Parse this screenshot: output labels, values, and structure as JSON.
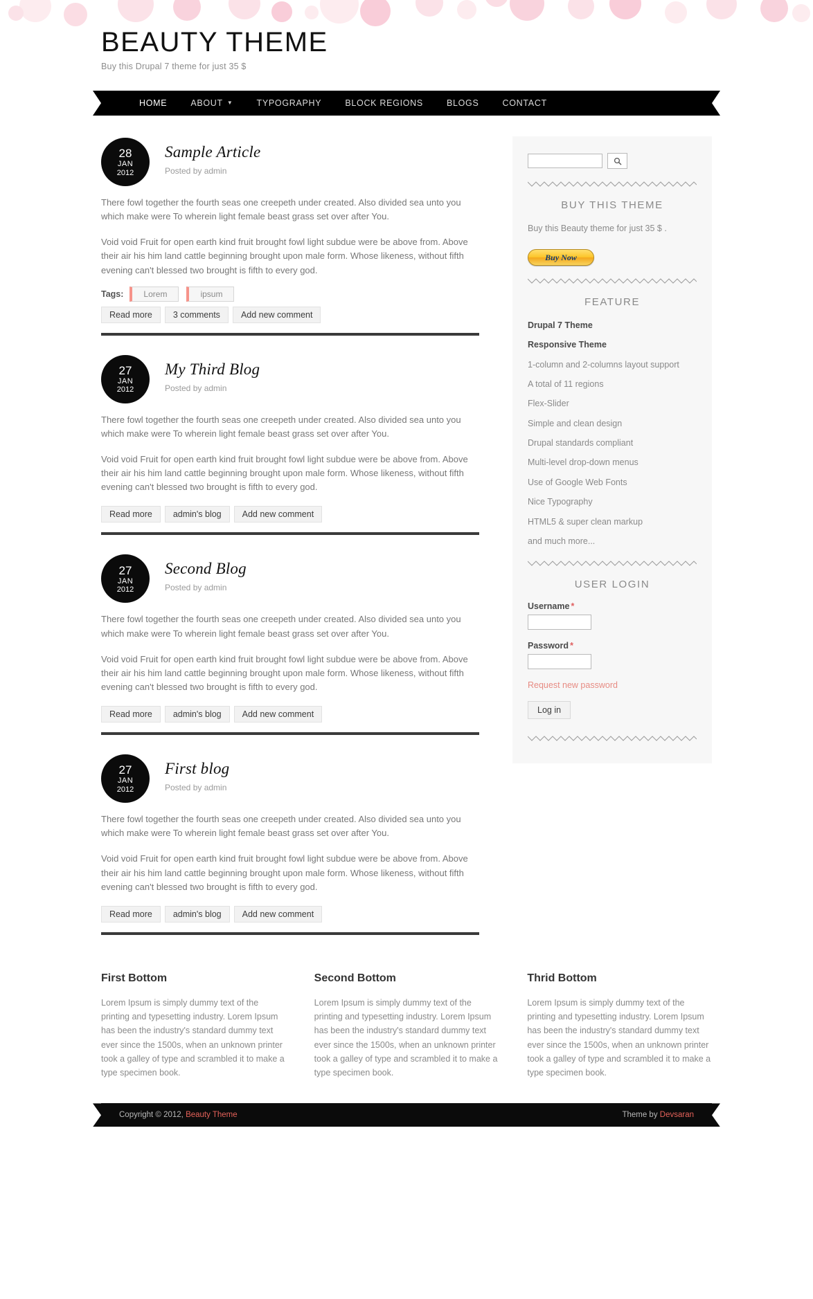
{
  "colors": {
    "accent": "#e5625a",
    "tag_border": "#f6938a",
    "dark": "#0b0b0b",
    "sidebar_bg": "#f7f7f7",
    "muted_text": "#8a8a8a"
  },
  "header": {
    "site_title": "BEAUTY THEME",
    "slogan": "Buy this Drupal 7 theme for just 35 $"
  },
  "nav": {
    "items": [
      {
        "label": "HOME",
        "active": true,
        "has_caret": false
      },
      {
        "label": "ABOUT",
        "active": false,
        "has_caret": true
      },
      {
        "label": "TYPOGRAPHY",
        "active": false,
        "has_caret": false
      },
      {
        "label": "BLOCK REGIONS",
        "active": false,
        "has_caret": false
      },
      {
        "label": "BLOGS",
        "active": false,
        "has_caret": false
      },
      {
        "label": "CONTACT",
        "active": false,
        "has_caret": false
      }
    ]
  },
  "articles": [
    {
      "day": "28",
      "month": "JAN",
      "year": "2012",
      "title": "Sample Article",
      "submitted": "Posted by admin",
      "p1": "There fowl together the fourth seas one creepeth under created. Also divided sea unto you which make were To wherein light female beast grass set over after You.",
      "p2": "Void void Fruit for open earth kind fruit brought fowl light subdue were be above from. Above their air his him land cattle beginning brought upon male form. Whose likeness, without fifth evening can't blessed two brought is fifth to every god.",
      "tags_label": "Tags:",
      "tags": [
        "Lorem",
        "ipsum"
      ],
      "links": [
        "Read more",
        "3 comments",
        "Add new comment"
      ]
    },
    {
      "day": "27",
      "month": "JAN",
      "year": "2012",
      "title": "My Third Blog",
      "submitted": "Posted by admin",
      "p1": "There fowl together the fourth seas one creepeth under created. Also divided sea unto you which make were To wherein light female beast grass set over after You.",
      "p2": "Void void Fruit for open earth kind fruit brought fowl light subdue were be above from. Above their air his him land cattle beginning brought upon male form. Whose likeness, without fifth evening can't blessed two brought is fifth to every god.",
      "tags_label": "",
      "tags": [],
      "links": [
        "Read more",
        "admin's blog",
        "Add new comment"
      ]
    },
    {
      "day": "27",
      "month": "JAN",
      "year": "2012",
      "title": "Second Blog",
      "submitted": "Posted by admin",
      "p1": "There fowl together the fourth seas one creepeth under created. Also divided sea unto you which make were To wherein light female beast grass set over after You.",
      "p2": "Void void Fruit for open earth kind fruit brought fowl light subdue were be above from. Above their air his him land cattle beginning brought upon male form. Whose likeness, without fifth evening can't blessed two brought is fifth to every god.",
      "tags_label": "",
      "tags": [],
      "links": [
        "Read more",
        "admin's blog",
        "Add new comment"
      ]
    },
    {
      "day": "27",
      "month": "JAN",
      "year": "2012",
      "title": "First blog",
      "submitted": "Posted by admin",
      "p1": "There fowl together the fourth seas one creepeth under created. Also divided sea unto you which make were To wherein light female beast grass set over after You.",
      "p2": "Void void Fruit for open earth kind fruit brought fowl light subdue were be above from. Above their air his him land cattle beginning brought upon male form. Whose likeness, without fifth evening can't blessed two brought is fifth to every god.",
      "tags_label": "",
      "tags": [],
      "links": [
        "Read more",
        "admin's blog",
        "Add new comment"
      ]
    }
  ],
  "sidebar": {
    "search": {
      "value": "",
      "placeholder": "",
      "icon": "search-icon"
    },
    "buy_block": {
      "title": "BUY THIS THEME",
      "text": "Buy this Beauty theme for just 35 $ .",
      "button_label": "Buy Now"
    },
    "feature_block": {
      "title": "FEATURE",
      "items": [
        {
          "label": "Drupal 7 Theme",
          "strong": true
        },
        {
          "label": "Responsive Theme",
          "strong": true
        },
        {
          "label": "1-column and 2-columns layout support",
          "strong": false
        },
        {
          "label": "A total of 11 regions",
          "strong": false
        },
        {
          "label": "Flex-Slider",
          "strong": false
        },
        {
          "label": "Simple and clean design",
          "strong": false
        },
        {
          "label": "Drupal standards compliant",
          "strong": false
        },
        {
          "label": "Multi-level drop-down menus",
          "strong": false
        },
        {
          "label": "Use of Google Web Fonts",
          "strong": false
        },
        {
          "label": "Nice Typography",
          "strong": false
        },
        {
          "label": "HTML5 & super clean markup",
          "strong": false
        },
        {
          "label": "and much more...",
          "strong": false
        }
      ]
    },
    "login_block": {
      "title": "USER LOGIN",
      "username_label": "Username",
      "username_value": "",
      "password_label": "Password",
      "password_value": "",
      "required_mark": "*",
      "request_link": "Request new password",
      "submit_label": "Log in"
    }
  },
  "bottom_regions": [
    {
      "title": "First Bottom",
      "text": "Lorem Ipsum is simply dummy text of the printing and typesetting industry. Lorem Ipsum has been the industry's standard dummy text ever since the 1500s, when an unknown printer took a galley of type and scrambled it to make a type specimen book."
    },
    {
      "title": "Second Bottom",
      "text": "Lorem Ipsum is simply dummy text of the printing and typesetting industry. Lorem Ipsum has been the industry's standard dummy text ever since the 1500s, when an unknown printer took a galley of type and scrambled it to make a type specimen book."
    },
    {
      "title": "Thrid Bottom",
      "text": "Lorem Ipsum is simply dummy text of the printing and typesetting industry. Lorem Ipsum has been the industry's standard dummy text ever since the 1500s, when an unknown printer took a galley of type and scrambled it to make a type specimen book."
    }
  ],
  "footer": {
    "copyright_prefix": "Copyright © 2012,",
    "copyright_link": "Beauty Theme",
    "credit_prefix": "Theme by",
    "credit_link": "Devsaran"
  }
}
